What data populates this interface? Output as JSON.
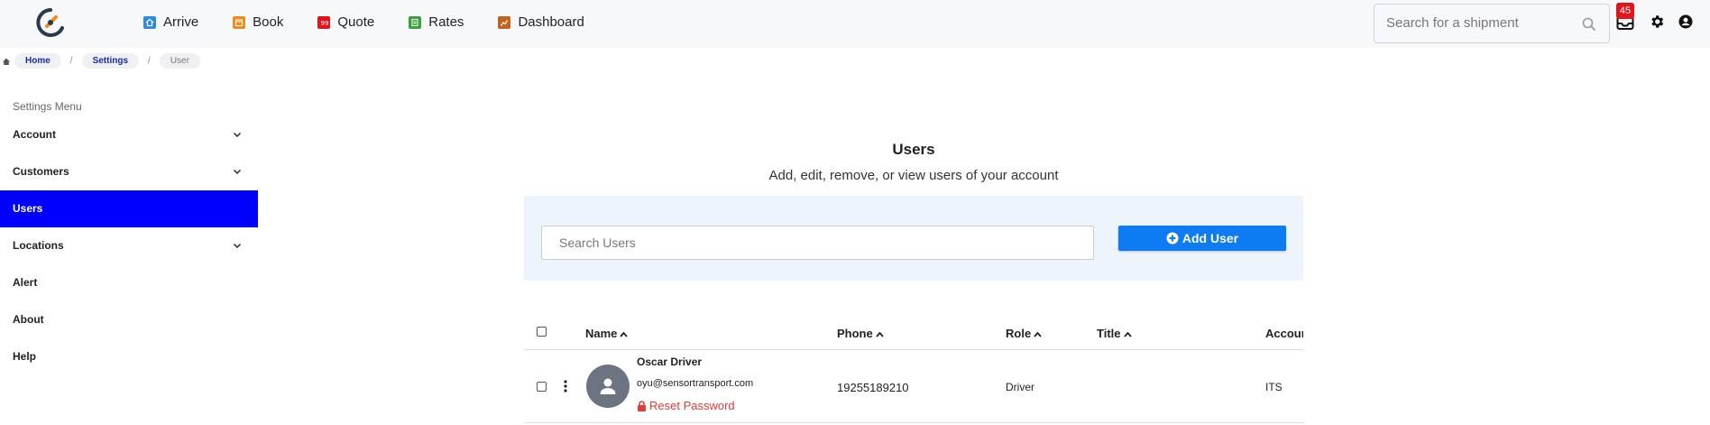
{
  "nav": {
    "items": [
      {
        "label": "Arrive",
        "icon": "home-icon",
        "color": "#2f8ae5"
      },
      {
        "label": "Book",
        "icon": "calendar-icon",
        "color": "#f08a1c"
      },
      {
        "label": "Quote",
        "icon": "quote-icon",
        "color": "#e0151b"
      },
      {
        "label": "Rates",
        "icon": "rates-table-icon",
        "color": "#3aa23a"
      },
      {
        "label": "Dashboard",
        "icon": "chart-icon",
        "color": "#c0651b"
      }
    ],
    "search_placeholder": "Search for a shipment",
    "notification_count": "45"
  },
  "breadcrumb": {
    "items": [
      "Home",
      "Settings",
      "User"
    ],
    "separator": "/"
  },
  "sidebar": {
    "title": "Settings Menu",
    "items": [
      {
        "label": "Account",
        "expandable": true
      },
      {
        "label": "Customers",
        "expandable": true
      },
      {
        "label": "Users",
        "active": true
      },
      {
        "label": "Locations",
        "expandable": true
      },
      {
        "label": "Alert"
      },
      {
        "label": "About"
      },
      {
        "label": "Help"
      }
    ],
    "active_color": "#0000ff"
  },
  "main": {
    "title": "Users",
    "subtitle": "Add, edit, remove, or view users of your account",
    "search_placeholder": "Search Users",
    "add_button": "Add User",
    "accent": "#0d7cf2"
  },
  "table": {
    "columns": [
      "Name",
      "Phone",
      "Role",
      "Title",
      "Accour"
    ],
    "rows": [
      {
        "name": "Oscar Driver",
        "email": "oyu@sensortransport.com",
        "reset": "Reset Password",
        "phone": "19255189210",
        "role": "Driver",
        "title": "",
        "account": "ITS"
      }
    ]
  }
}
